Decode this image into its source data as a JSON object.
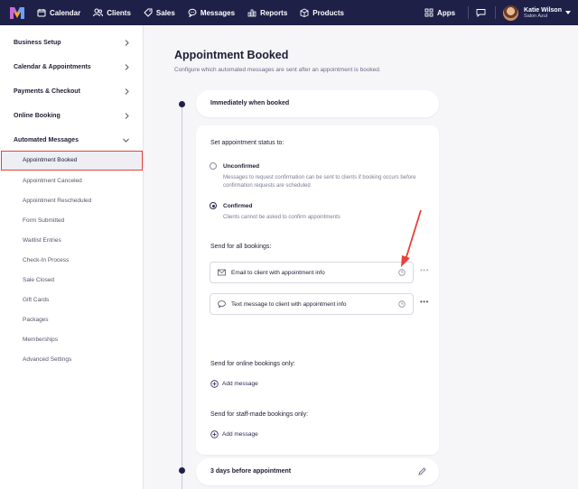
{
  "nav": {
    "items": [
      {
        "label": "Calendar",
        "icon": "calendar-icon"
      },
      {
        "label": "Clients",
        "icon": "clients-icon"
      },
      {
        "label": "Sales",
        "icon": "tag-icon"
      },
      {
        "label": "Messages",
        "icon": "chat-icon"
      },
      {
        "label": "Reports",
        "icon": "bar-chart-icon"
      },
      {
        "label": "Products",
        "icon": "box-icon"
      }
    ],
    "apps_label": "Apps",
    "user_name": "Katie Wilson",
    "business_name": "Salon Azul"
  },
  "sidebar": {
    "sections": [
      {
        "label": "Business Setup"
      },
      {
        "label": "Calendar & Appointments"
      },
      {
        "label": "Payments & Checkout"
      },
      {
        "label": "Online Booking"
      },
      {
        "label": "Automated Messages"
      }
    ],
    "active_sub": "Appointment Booked",
    "subs": [
      "Appointment Canceled",
      "Appointment Rescheduled",
      "Form Submitted",
      "Waitlist Entries",
      "Check-In Process",
      "Sale Closed",
      "Gift Cards",
      "Packages",
      "Memberships",
      "Advanced Settings"
    ]
  },
  "main": {
    "title": "Appointment Booked",
    "subtitle": "Configure which automated messages are sent after an appointment is booked.",
    "trigger1": "Immediately when booked",
    "status_label": "Set appointment status to:",
    "options": [
      {
        "label": "Unconfirmed",
        "help": "Messages to request confirmation can be sent to clients if booking occurs before confirmation requests are scheduled",
        "selected": false
      },
      {
        "label": "Confirmed",
        "help": "Clients cannot be asked to confirm appointments",
        "selected": true
      }
    ],
    "all_bookings_label": "Send for all bookings:",
    "messages": [
      {
        "text": "Email to client with appointment info",
        "icon": "envelope-icon"
      },
      {
        "text": "Text message to client with appointment info",
        "icon": "sms-icon"
      }
    ],
    "online_label": "Send for online bookings only:",
    "staff_label": "Send for staff-made bookings only:",
    "add_message": "Add message",
    "trigger2": "3 days before appointment"
  },
  "colors": {
    "nav_bg": "#1f2048",
    "highlight_border": "#e8413a",
    "arrow": "#e8413a"
  }
}
